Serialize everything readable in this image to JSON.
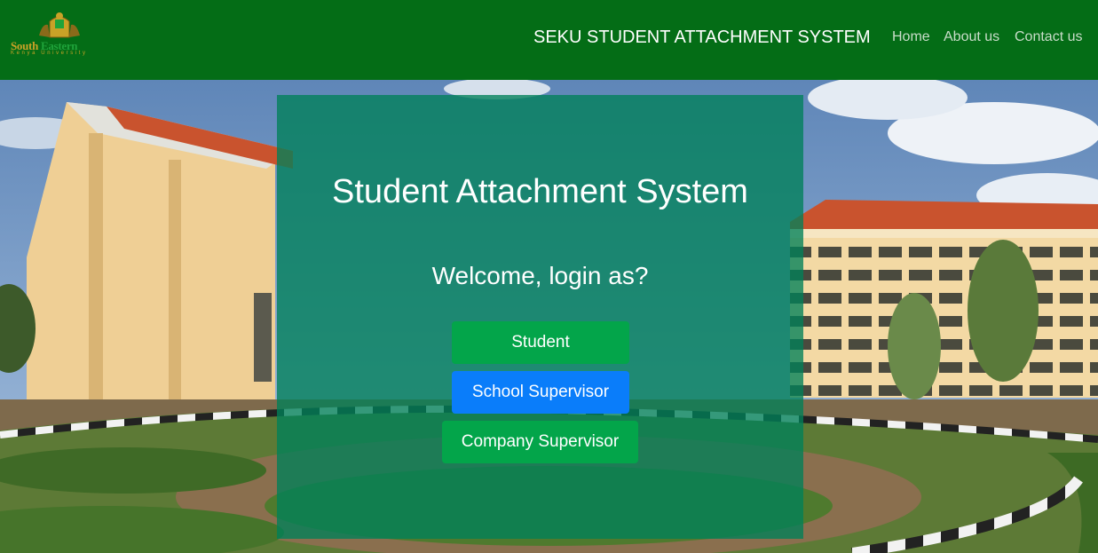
{
  "navbar": {
    "logo": {
      "name_part1": "South ",
      "name_part2": "Eastern",
      "subtitle": "Kenya University"
    },
    "brand": "SEKU STUDENT ATTACHMENT SYSTEM",
    "links": {
      "home": "Home",
      "about": "About us",
      "contact": "Contact us"
    }
  },
  "panel": {
    "title": "Student Attachment System",
    "welcome": "Welcome, login as?",
    "buttons": {
      "student": "Student",
      "school_supervisor": "School Supervisor",
      "company_supervisor": "Company Supervisor"
    }
  },
  "colors": {
    "navbar_bg": "#046d16",
    "panel_bg": "#008058",
    "button_green": "#03a54a",
    "button_blue": "#0a7dfa"
  }
}
